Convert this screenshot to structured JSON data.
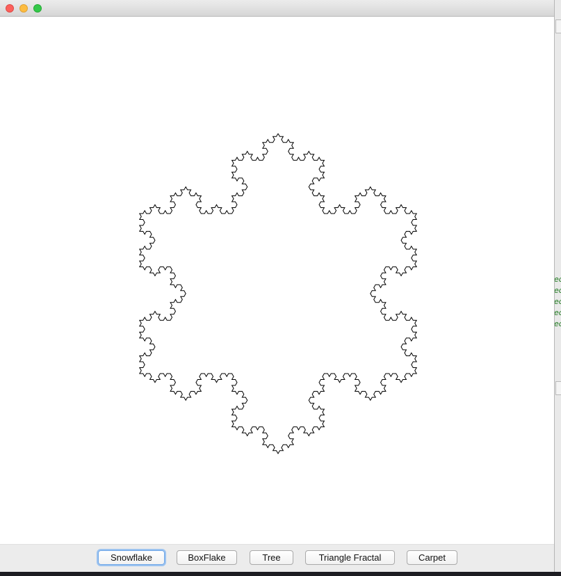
{
  "window": {
    "title": "",
    "controls": {
      "close": "close-button",
      "minimize": "minimize-button",
      "maximize": "maximize-button"
    }
  },
  "canvas": {
    "fractal": "Koch snowflake",
    "stroke_color": "#000000",
    "background": "#ffffff"
  },
  "buttons": [
    {
      "label": "Snowflake"
    },
    {
      "label": "BoxFlake"
    },
    {
      "label": "Tree"
    },
    {
      "label": "Triangle Fractal"
    },
    {
      "label": "Carpet"
    }
  ],
  "background_window": {
    "gutter_lines": [
      "ed",
      "ed",
      "ed",
      "ed",
      "ed"
    ],
    "text_color": "#1f7a1f"
  }
}
